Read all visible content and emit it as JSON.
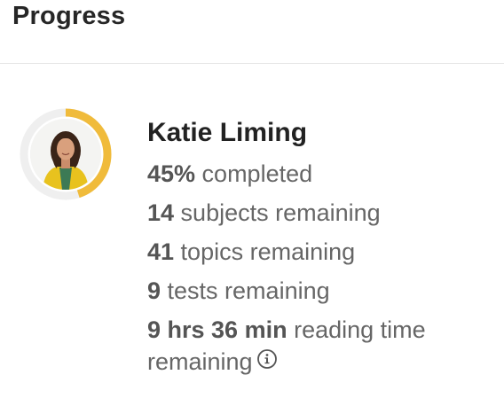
{
  "header": {
    "title": "Progress"
  },
  "profile": {
    "name": "Katie Liming",
    "progress_fraction": 0.45,
    "ring_color": "#F0BB3B",
    "ring_track_color": "#EFEFEF"
  },
  "stats": {
    "completed_value": "45%",
    "completed_label": " completed",
    "subjects_value": "14",
    "subjects_label": " subjects remaining",
    "topics_value": "41",
    "topics_label": " topics remaining",
    "tests_value": "9",
    "tests_label": " tests remaining",
    "reading_value": "9 hrs 36 min",
    "reading_label": " reading time remaining",
    "info_icon": "info-circle-icon"
  }
}
